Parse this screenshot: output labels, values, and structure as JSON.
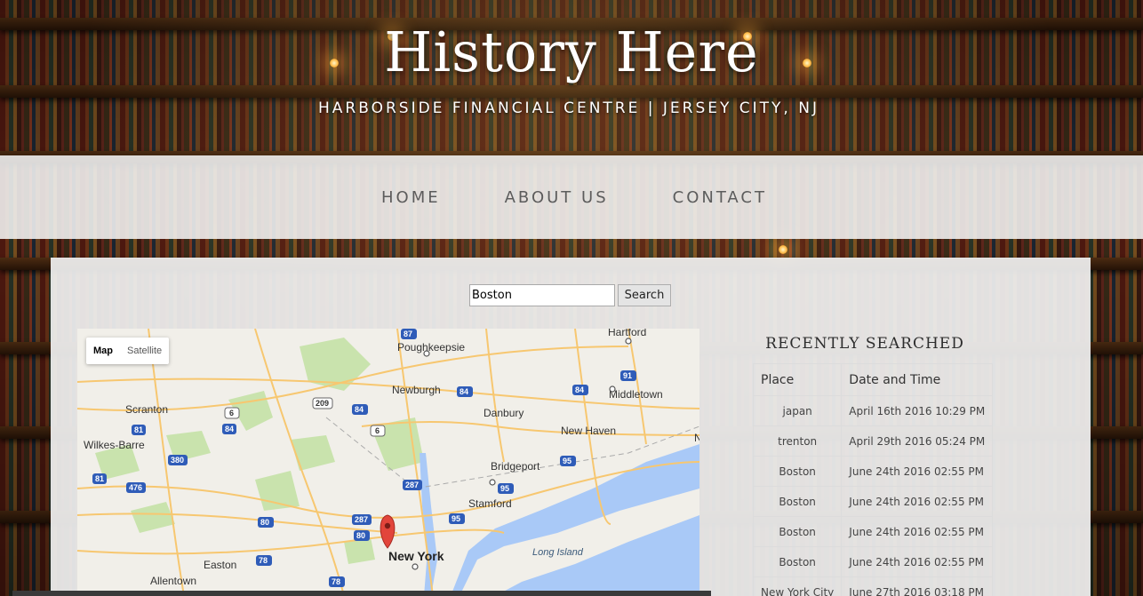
{
  "header": {
    "title": "History Here",
    "subtitle": "HARBORSIDE FINANCIAL CENTRE | JERSEY CITY, NJ"
  },
  "nav": {
    "items": [
      {
        "label": "HOME"
      },
      {
        "label": "ABOUT US"
      },
      {
        "label": "CONTACT"
      }
    ]
  },
  "search": {
    "value": "Boston",
    "button_label": "Search"
  },
  "map": {
    "type_controls": {
      "map": "Map",
      "satellite": "Satellite"
    },
    "places": [
      "Hartford",
      "Poughkeepsie",
      "Newburgh",
      "Middletown",
      "Scranton",
      "Danbury",
      "Wilkes-Barre",
      "New Haven",
      "Bridgeport",
      "Stamford",
      "New York",
      "Long Island",
      "Easton",
      "Allentown",
      "N"
    ],
    "shields": [
      "87",
      "91",
      "84",
      "84",
      "84",
      "209",
      "6",
      "6",
      "81",
      "84",
      "380",
      "81",
      "476",
      "287",
      "95",
      "95",
      "287",
      "80",
      "80",
      "95",
      "78",
      "78"
    ],
    "colors": {
      "land": "#f1efe9",
      "water": "#a9c9f7",
      "park": "#c9e3ad",
      "road": "#f7c770",
      "pin": "#e2453b"
    }
  },
  "recent": {
    "title": "RECENTLY SEARCHED",
    "columns": [
      "Place",
      "Date and Time"
    ],
    "rows": [
      {
        "place": "japan",
        "time": "April 16th 2016 10:29 PM"
      },
      {
        "place": "trenton",
        "time": "April 29th 2016 05:24 PM"
      },
      {
        "place": "Boston",
        "time": "June 24th 2016 02:55 PM"
      },
      {
        "place": "Boston",
        "time": "June 24th 2016 02:55 PM"
      },
      {
        "place": "Boston",
        "time": "June 24th 2016 02:55 PM"
      },
      {
        "place": "Boston",
        "time": "June 24th 2016 02:55 PM"
      },
      {
        "place": "New York City",
        "time": "June 27th 2016 03:18 PM"
      }
    ]
  }
}
